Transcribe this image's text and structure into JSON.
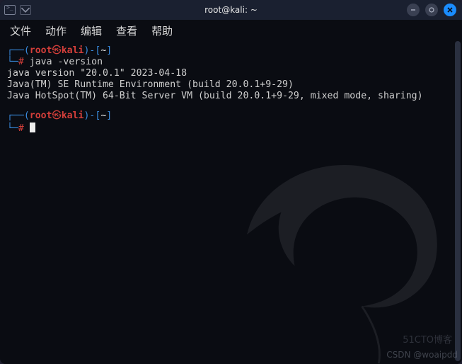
{
  "titlebar": {
    "title": "root@kali: ~",
    "new_tab_glyph": "⌄"
  },
  "menubar": {
    "items": [
      "文件",
      "动作",
      "编辑",
      "查看",
      "帮助"
    ]
  },
  "terminal": {
    "prompt_blocks": [
      {
        "top_open": "┌──(",
        "user": "root",
        "at": "㉿",
        "host": "kali",
        "top_mid": ")-[",
        "cwd": "~",
        "top_close": "]",
        "bottom_open": "└─",
        "hash": "#",
        "command": "java -version",
        "output_lines": [
          "java version \"20.0.1\" 2023-04-18",
          "Java(TM) SE Runtime Environment (build 20.0.1+9-29)",
          "Java HotSpot(TM) 64-Bit Server VM (build 20.0.1+9-29, mixed mode, sharing)"
        ]
      },
      {
        "top_open": "┌──(",
        "user": "root",
        "at": "㉿",
        "host": "kali",
        "top_mid": ")-[",
        "cwd": "~",
        "top_close": "]",
        "bottom_open": "└─",
        "hash": "#",
        "command": "",
        "output_lines": []
      }
    ]
  },
  "watermark1": "51CTO博客",
  "watermark2": "CSDN @woaipdd"
}
